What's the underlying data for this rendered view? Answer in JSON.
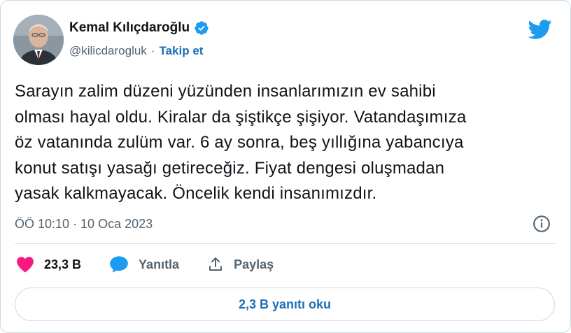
{
  "author": {
    "name": "Kemal Kılıçdaroğlu",
    "handle": "@kilicdarogluk",
    "separator": "·",
    "follow_label": "Takip et"
  },
  "tweet": {
    "lines": [
      "Sarayın zalim düzeni yüzünden insanlarımızın ev sahibi",
      "olması hayal oldu. Kiralar da şiştikçe şişiyor. Vatandaşımıza",
      "öz vatanında zulüm var. 6 ay sonra, beş yıllığına yabancıya",
      "konut satışı yasağı getireceğiz. Fiyat dengesi oluşmadan",
      "yasak kalkmayacak. Öncelik kendi insanımızdır."
    ],
    "timestamp": "ÖÖ 10:10 · 10 Oca 2023"
  },
  "actions": {
    "likes": "23,3 B",
    "reply_label": "Yanıtla",
    "share_label": "Paylaş"
  },
  "read_replies_label": "2,3 B yanıtı oku",
  "colors": {
    "accent": "#1d9bf0",
    "link": "#1d6fb8",
    "like": "#f91880",
    "muted": "#536471"
  },
  "icons": [
    "verified-badge-icon",
    "twitter-bird-icon",
    "info-icon",
    "heart-icon",
    "reply-bubble-icon",
    "share-icon"
  ]
}
